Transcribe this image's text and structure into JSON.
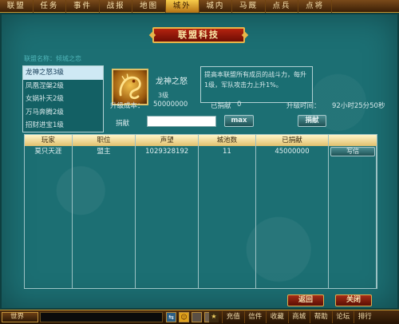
{
  "topnav": {
    "tabs": [
      "联盟",
      "任务",
      "事件",
      "战报",
      "地图",
      "城外",
      "城内",
      "马厩",
      "点兵",
      "点将"
    ],
    "active_index": 5
  },
  "panel": {
    "title": "联盟科技",
    "subheading": "联盟名称：倾城之恋"
  },
  "tech_list": {
    "items": [
      "龙神之怒3级",
      "凤凰涅槃2级",
      "女娲补天2级",
      "万马奔腾2级",
      "招财进宝1级"
    ],
    "selected_index": 0
  },
  "detail": {
    "name": "龙神之怒",
    "level": "3级",
    "icon": "golden-dragon-icon",
    "description": "提高本联盟所有成员的战斗力，每升1级，军队攻击力上升1%。",
    "upgrade_cost_label": "升级成本：",
    "upgrade_cost_value": "50000000",
    "donated_label": "已捐献",
    "donated_value": "0",
    "upgrade_time_label": "升级时间：",
    "upgrade_time_value": "92小时25分50秒",
    "donate_field_label": "捐献",
    "donate_input_value": "",
    "max_button": "max",
    "donate_button": "捐献"
  },
  "table": {
    "headers": [
      "玩家",
      "职位",
      "声望",
      "城池数",
      "已捐献",
      ""
    ],
    "rows": [
      {
        "player": "莫只天涯",
        "position": "盟主",
        "prestige": "1029328192",
        "cities": "11",
        "donated": "45000000",
        "action": "写信"
      }
    ]
  },
  "buttons": {
    "back": "返回",
    "close": "关闭"
  },
  "bottombar": {
    "channel": "世界",
    "chat_value": "",
    "menu": [
      "充值",
      "信件",
      "收藏",
      "商城",
      "帮助",
      "论坛",
      "排行"
    ]
  },
  "colors": {
    "background": "#1d6b6e",
    "header_gold": "#e1c06e",
    "title_red": "#8e1a0a"
  }
}
